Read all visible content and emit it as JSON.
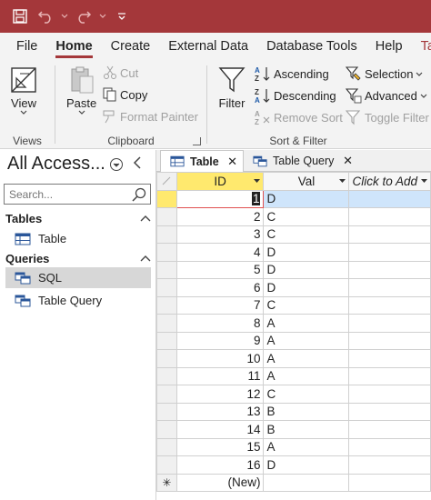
{
  "ribbon_tabs": [
    "File",
    "Home",
    "Create",
    "External Data",
    "Database Tools",
    "Help",
    "Ta"
  ],
  "groups": {
    "views": {
      "label": "Views",
      "view_btn": "View"
    },
    "clipboard": {
      "label": "Clipboard",
      "paste": "Paste",
      "cut": "Cut",
      "copy": "Copy",
      "format_painter": "Format Painter"
    },
    "sort_filter": {
      "label": "Sort & Filter",
      "filter": "Filter",
      "ascending": "Ascending",
      "descending": "Descending",
      "remove_sort": "Remove Sort",
      "selection": "Selection",
      "advanced": "Advanced",
      "toggle_filter": "Toggle Filter"
    }
  },
  "nav": {
    "title": "All Access...",
    "search_placeholder": "Search...",
    "tables_header": "Tables",
    "table_item": "Table",
    "queries_header": "Queries",
    "query_sql": "SQL",
    "query_table": "Table Query"
  },
  "doc_tabs": [
    "Table",
    "Table Query"
  ],
  "grid": {
    "columns": [
      "ID",
      "Val",
      "Click to Add"
    ],
    "rows": [
      {
        "id": "1",
        "val": "D"
      },
      {
        "id": "2",
        "val": "C"
      },
      {
        "id": "3",
        "val": "C"
      },
      {
        "id": "4",
        "val": "D"
      },
      {
        "id": "5",
        "val": "D"
      },
      {
        "id": "6",
        "val": "D"
      },
      {
        "id": "7",
        "val": "C"
      },
      {
        "id": "8",
        "val": "A"
      },
      {
        "id": "9",
        "val": "A"
      },
      {
        "id": "10",
        "val": "A"
      },
      {
        "id": "11",
        "val": "A"
      },
      {
        "id": "12",
        "val": "C"
      },
      {
        "id": "13",
        "val": "B"
      },
      {
        "id": "14",
        "val": "B"
      },
      {
        "id": "15",
        "val": "A"
      },
      {
        "id": "16",
        "val": "D"
      }
    ],
    "new_row": "(New)"
  },
  "colors": {
    "accent": "#a4373a",
    "header_highlight": "#ffe96e",
    "row_highlight": "#cfe5fb"
  }
}
